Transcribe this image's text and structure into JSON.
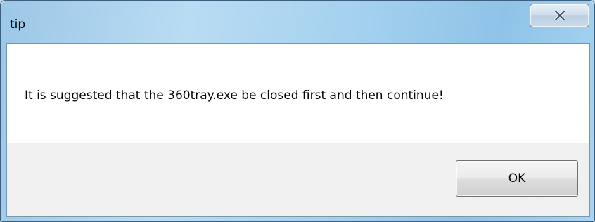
{
  "window": {
    "title": "tip"
  },
  "titlebar": {
    "close_icon": "close-x-icon"
  },
  "dialog": {
    "message": "It is suggested that the 360tray.exe be closed first and then continue!",
    "ok_label": "OK"
  }
}
